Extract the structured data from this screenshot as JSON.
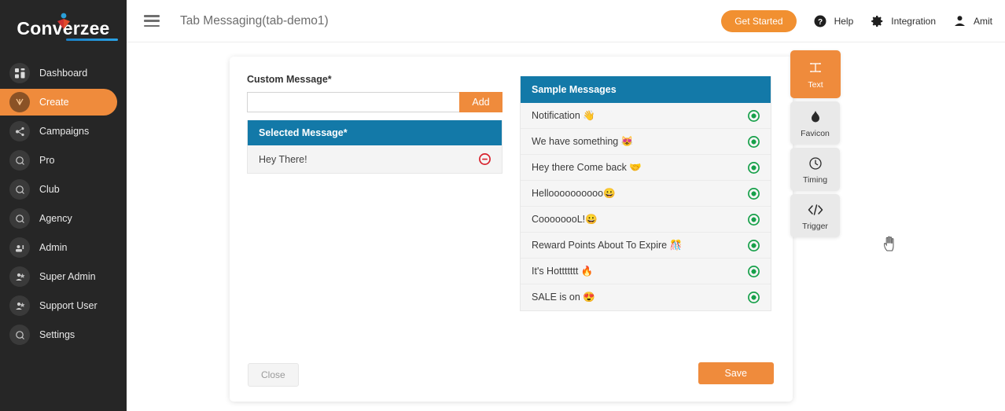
{
  "brand": {
    "name": "Converzee",
    "mark_icon": "person-logo-icon"
  },
  "sidebar": {
    "items": [
      {
        "label": "Dashboard",
        "icon": "grid-icon",
        "active": false
      },
      {
        "label": "Create",
        "icon": "create-icon",
        "active": true
      },
      {
        "label": "Campaigns",
        "icon": "campaigns-icon",
        "active": false
      },
      {
        "label": "Pro",
        "icon": "pro-icon",
        "active": false
      },
      {
        "label": "Club",
        "icon": "club-icon",
        "active": false
      },
      {
        "label": "Agency",
        "icon": "agency-icon",
        "active": false
      },
      {
        "label": "Admin",
        "icon": "admin-icon",
        "active": false
      },
      {
        "label": "Super Admin",
        "icon": "super-admin-icon",
        "active": false
      },
      {
        "label": "Support User",
        "icon": "support-user-icon",
        "active": false
      },
      {
        "label": "Settings",
        "icon": "settings-gear-icon",
        "active": false
      }
    ]
  },
  "header": {
    "menu_icon": "hamburger-icon",
    "title": "Tab Messaging(tab-demo1)",
    "get_started_label": "Get Started",
    "help_icon": "question-circle-icon",
    "help_label": "Help",
    "gear_icon": "gear-icon",
    "integration_label": "Integration",
    "user_icon": "user-avatar-icon",
    "user_name": "Amit"
  },
  "form": {
    "custom_message_label": "Custom Message*",
    "custom_message_value": "",
    "custom_message_placeholder": "",
    "add_button_label": "Add",
    "selected_message_header": "Selected Message*",
    "selected_messages": [
      {
        "text": "Hey There!",
        "remove_icon": "minus-circle-icon"
      }
    ]
  },
  "sample": {
    "header": "Sample Messages",
    "messages": [
      {
        "text": "Notification 👋",
        "add_icon": "plus-circle-icon"
      },
      {
        "text": "We have something 😻",
        "add_icon": "plus-circle-icon"
      },
      {
        "text": "Hey there Come back 🤝",
        "add_icon": "plus-circle-icon"
      },
      {
        "text": "Helloooooooooo😀",
        "add_icon": "plus-circle-icon"
      },
      {
        "text": "CoooooooL!😀",
        "add_icon": "plus-circle-icon"
      },
      {
        "text": "Reward Points About To Expire 🎊",
        "add_icon": "plus-circle-icon"
      },
      {
        "text": "It's Hottttttt 🔥",
        "add_icon": "plus-circle-icon"
      },
      {
        "text": "SALE is on 😍",
        "add_icon": "plus-circle-icon"
      }
    ]
  },
  "tabs": [
    {
      "label": "Text",
      "icon": "text-t-icon",
      "active": true
    },
    {
      "label": "Favicon",
      "icon": "favicon-icon",
      "active": false
    },
    {
      "label": "Timing",
      "icon": "clock-icon",
      "active": false
    },
    {
      "label": "Trigger",
      "icon": "code-tags-icon",
      "active": false
    }
  ],
  "footer": {
    "close_label": "Close",
    "save_label": "Save"
  },
  "colors": {
    "accent_orange": "#ef8b3c",
    "panel_blue": "#1379a8",
    "sidebar_dark": "#262626",
    "add_green": "#17a04a",
    "remove_red": "#d8222d"
  }
}
